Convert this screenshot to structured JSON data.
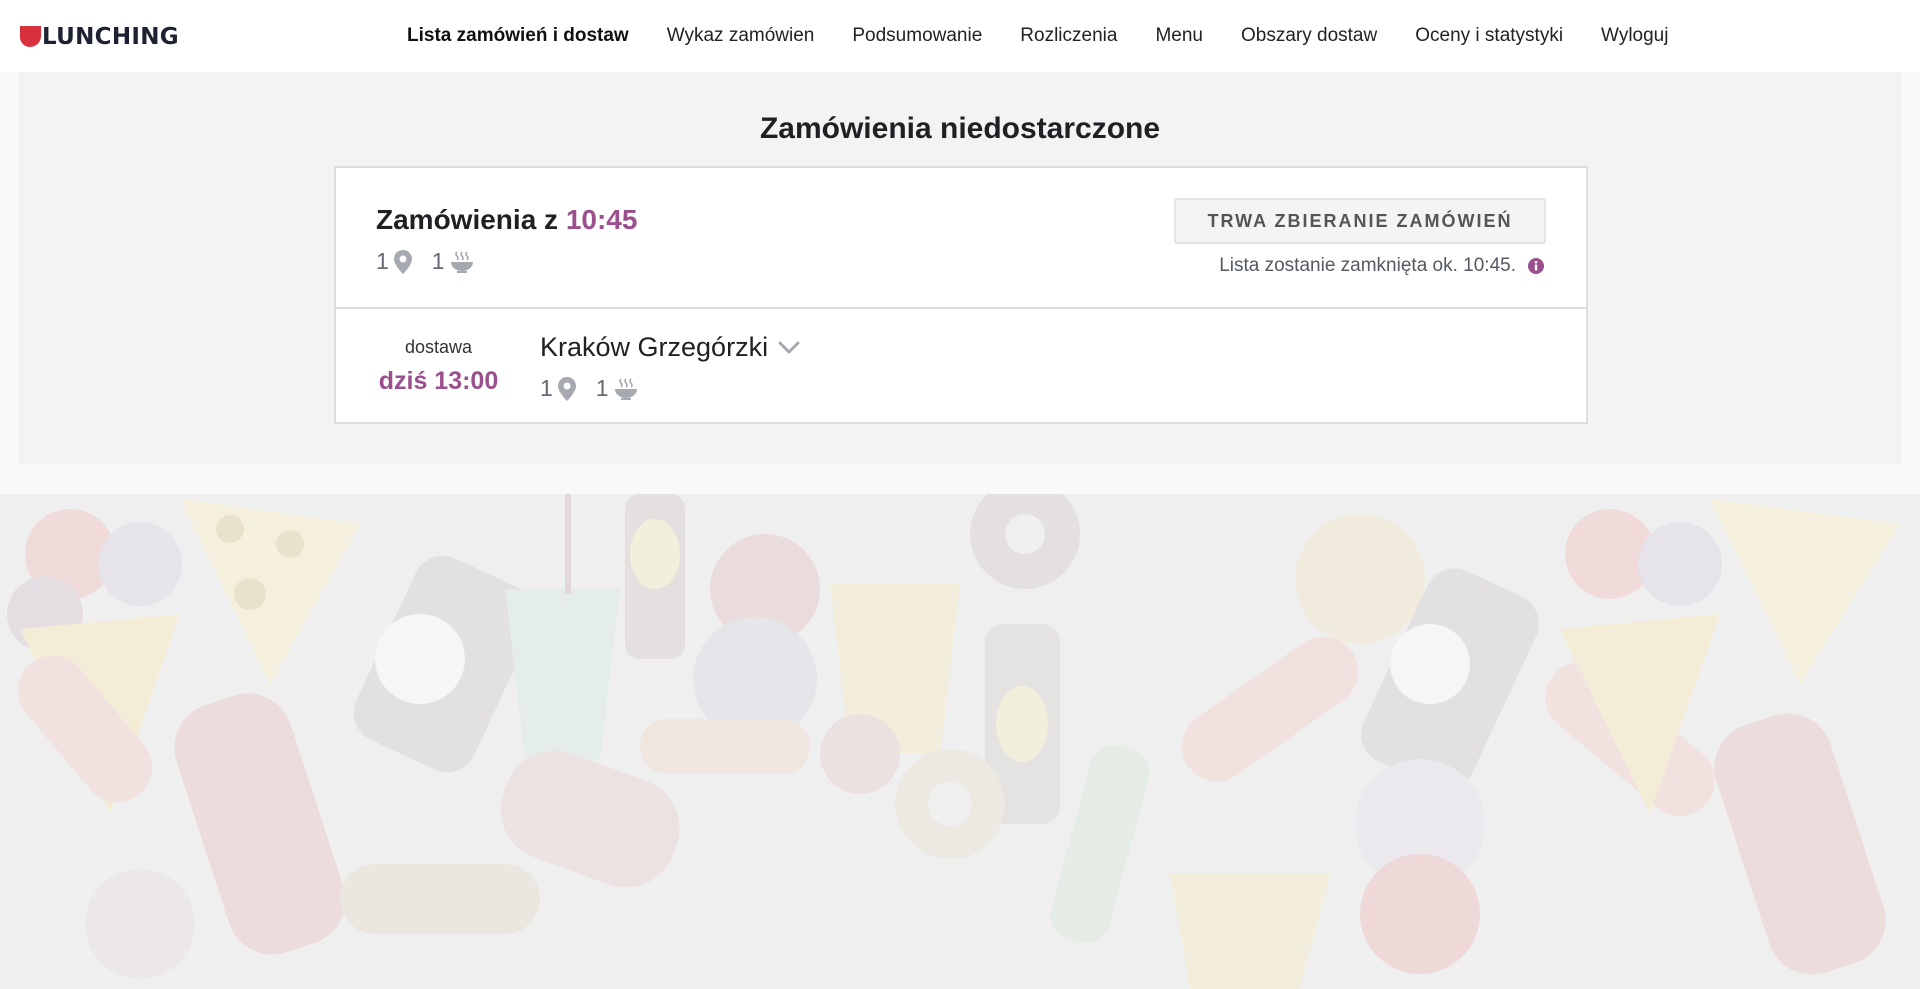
{
  "header": {
    "logo_text": "LUNCHING",
    "logo_color": "#d9303e",
    "nav": [
      {
        "label": "Lista zamówień i dostaw",
        "active": true
      },
      {
        "label": "Wykaz zamówien",
        "active": false
      },
      {
        "label": "Podsumowanie",
        "active": false
      },
      {
        "label": "Rozliczenia",
        "active": false
      },
      {
        "label": "Menu",
        "active": false
      },
      {
        "label": "Obszary dostaw",
        "active": false
      },
      {
        "label": "Oceny i statystyki",
        "active": false
      },
      {
        "label": "Wyloguj",
        "active": false
      }
    ]
  },
  "main": {
    "section_title": "Zamówienia niedostarczone",
    "batch": {
      "title_prefix": "Zamówienia z",
      "time": "10:45",
      "locations_count": "1",
      "meals_count": "1",
      "status_button": "TRWA ZBIERANIE ZAMÓWIEŃ",
      "close_note": "Lista zostanie zamknięta ok. 10:45.",
      "delivery": {
        "label": "dostawa",
        "time": "dziś 13:00",
        "area": "Kraków Grzegórzki",
        "locations_count": "1",
        "meals_count": "1"
      }
    }
  },
  "icons": {
    "location": "location-pin-icon",
    "meal": "soup-bowl-icon",
    "info": "info-icon",
    "expand": "chevron-down-icon"
  },
  "colors": {
    "accent": "#9b4f8c",
    "brand": "#d9303e",
    "text_dark": "#1f1f24",
    "icon_gray": "#a6a9b0"
  }
}
